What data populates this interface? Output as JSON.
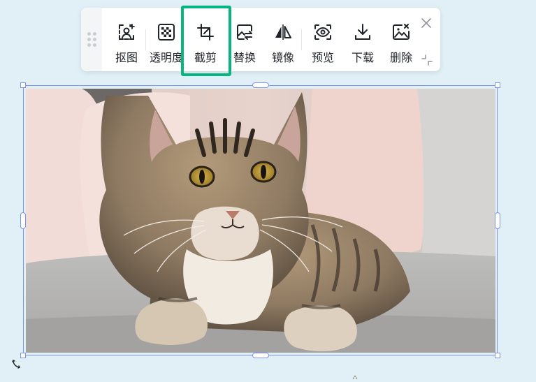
{
  "toolbar": {
    "tools": [
      {
        "id": "cutout",
        "label": "抠图",
        "icon": "portrait-cutout-icon"
      },
      {
        "id": "transparency",
        "label": "透明度",
        "icon": "checkerboard-icon"
      },
      {
        "id": "crop",
        "label": "截剪",
        "icon": "crop-icon",
        "highlighted": true
      },
      {
        "id": "replace",
        "label": "替换",
        "icon": "image-replace-icon"
      },
      {
        "id": "mirror",
        "label": "镜像",
        "icon": "mirror-flip-icon"
      },
      {
        "id": "preview",
        "label": "预览",
        "icon": "eye-icon"
      },
      {
        "id": "download",
        "label": "下载",
        "icon": "download-icon"
      },
      {
        "id": "delete",
        "label": "删除",
        "icon": "image-delete-icon"
      }
    ],
    "close_icon": "close-icon",
    "shrink_icon": "shrink-icon"
  },
  "colors": {
    "highlight": "#08b47f",
    "selection": "#7b93ef",
    "background": "#e1f0f7"
  },
  "image": {
    "subject": "tabby-cat-photo"
  }
}
